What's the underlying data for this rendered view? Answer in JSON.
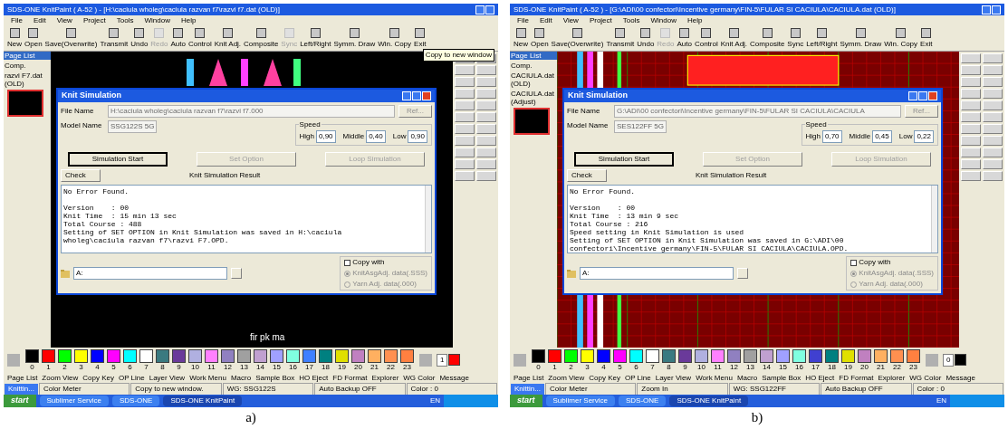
{
  "panels": [
    {
      "caption": "a)",
      "canvas": {
        "kind": "motif",
        "label": "fir pk ma"
      },
      "title": "SDS-ONE KnitPaint ( A-52 ) - [H:\\caciula wholeg\\caciula razvan f7\\razvi f7.dat (OLD)]",
      "menu": [
        "File",
        "Edit",
        "View",
        "Project",
        "Tools",
        "Window",
        "Help"
      ],
      "toolbar": [
        {
          "label": "New",
          "disabled": false
        },
        {
          "label": "Open",
          "disabled": false
        },
        {
          "label": "Save(Overwrite)",
          "disabled": false
        },
        {
          "label": "Transmit",
          "disabled": false
        },
        {
          "label": "Undo",
          "disabled": false
        },
        {
          "label": "Redo",
          "disabled": true
        },
        {
          "label": "Auto",
          "disabled": false
        },
        {
          "label": "Control",
          "disabled": false
        },
        {
          "label": "Knit Adj.",
          "disabled": false
        },
        {
          "label": "Composite",
          "disabled": false
        },
        {
          "label": "Sync",
          "disabled": true
        },
        {
          "label": "Left/Right",
          "disabled": false
        },
        {
          "label": "Symm. Draw",
          "disabled": false
        },
        {
          "label": "Win. Copy",
          "disabled": false
        },
        {
          "label": "Exit",
          "disabled": false
        }
      ],
      "tooltip": "Copy to new window",
      "sidebar": [
        {
          "label": "Page List",
          "selected": true
        },
        {
          "label": "Comp.",
          "selected": false
        },
        {
          "label": "razvi F7.dat (OLD)",
          "selected": false
        }
      ],
      "dialog": {
        "title": "Knit Simulation",
        "file_label": "File Name",
        "file_value": "H:\\caciula wholeg\\caciula razvan f7\\razvi f7.000",
        "ref_button": "Ref...",
        "model_label": "Model Name",
        "model_value": "SSG122S 5G",
        "speed_label": "Speed",
        "speeds": [
          {
            "label": "High",
            "value": "0,90"
          },
          {
            "label": "Middle",
            "value": "0,40"
          },
          {
            "label": "Low",
            "value": "0,90"
          }
        ],
        "buttons": [
          {
            "label": "Simulation Start",
            "disabled": false
          },
          {
            "label": "Set Option",
            "disabled": true
          },
          {
            "label": "Loop Simulation",
            "disabled": true
          }
        ],
        "check": "Check",
        "result_title": "Knit Simulation Result",
        "result": [
          "No Error Found.",
          "Version    : 00",
          "Knit Time  : 15 min 13 sec",
          "Total Course : 488",
          "Setting of SET OPTION in Knit Simulation was saved in H:\\caciula",
          "wholeg\\caciula razvan f7\\razvi F7.OPD."
        ],
        "drive": "A:",
        "copy_with": {
          "label": "Copy with",
          "checked": false
        },
        "radios": [
          {
            "label": "KnitAsgAdj. data(.SSS)",
            "selected": true
          },
          {
            "label": "Yarn Adj. data(.000)",
            "selected": false
          }
        ]
      },
      "palette": [
        {
          "n": "0",
          "color": "#000000"
        },
        {
          "n": "1",
          "color": "#ff0000"
        },
        {
          "n": "2",
          "color": "#00ff00"
        },
        {
          "n": "3",
          "color": "#ffff00"
        },
        {
          "n": "4",
          "color": "#0000ff"
        },
        {
          "n": "5",
          "color": "#ff00ff"
        },
        {
          "n": "6",
          "color": "#00ffff"
        },
        {
          "n": "7",
          "color": "#ffffff"
        },
        {
          "n": "8",
          "color": "#3a7a80"
        },
        {
          "n": "9",
          "color": "#6a3a9a"
        },
        {
          "n": "10",
          "color": "#b0b0e0"
        },
        {
          "n": "11",
          "color": "#ff80ff"
        },
        {
          "n": "12",
          "color": "#9080c0"
        },
        {
          "n": "13",
          "color": "#a0a0a0"
        },
        {
          "n": "14",
          "color": "#c0a0d0"
        },
        {
          "n": "15",
          "color": "#a0a0ff"
        },
        {
          "n": "16",
          "color": "#80ffe0"
        },
        {
          "n": "17",
          "color": "#4080ff"
        },
        {
          "n": "18",
          "color": "#008080"
        },
        {
          "n": "19",
          "color": "#e0e000"
        },
        {
          "n": "20",
          "color": "#c080c0"
        },
        {
          "n": "21",
          "color": "#ffb060"
        },
        {
          "n": "22",
          "color": "#ff9050"
        },
        {
          "n": "23",
          "color": "#ff8040"
        }
      ],
      "current_color": {
        "n": "1",
        "color": "#ff0000"
      },
      "bottom_tools": [
        "Page List",
        "Zoom View",
        "Copy Key",
        "OP Line",
        "Layer View",
        "Work Menu",
        "Macro",
        "Sample Box",
        "HO Eject",
        "FD Format",
        "Explorer",
        "WG Color",
        "Message"
      ],
      "status": [
        "Knittin...",
        "Color Meter",
        "Copy to new window.",
        "WG: SSG122S",
        "Auto Backup OFF",
        "Color : 0"
      ],
      "taskbar": {
        "start": "start",
        "items": [
          "Sublimer Service",
          "SDS-ONE",
          "SDS-ONE KnitPaint"
        ],
        "lang": "EN"
      }
    },
    {
      "caption": "b)",
      "canvas": {
        "kind": "grid"
      },
      "title": "SDS-ONE KnitPaint ( A-52 ) - [G:\\ADI\\00 confectori\\Incentive germany\\FIN-5\\FULAR SI CACIULA\\CACIULA.dat (OLD)]",
      "menu": [
        "File",
        "Edit",
        "View",
        "Project",
        "Tools",
        "Window",
        "Help"
      ],
      "toolbar": [
        {
          "label": "New",
          "disabled": false
        },
        {
          "label": "Open",
          "disabled": false
        },
        {
          "label": "Save(Overwrite)",
          "disabled": false
        },
        {
          "label": "Transmit",
          "disabled": false
        },
        {
          "label": "Undo",
          "disabled": false
        },
        {
          "label": "Redo",
          "disabled": true
        },
        {
          "label": "Auto",
          "disabled": false
        },
        {
          "label": "Control",
          "disabled": false
        },
        {
          "label": "Knit Adj.",
          "disabled": false
        },
        {
          "label": "Composite",
          "disabled": false
        },
        {
          "label": "Sync",
          "disabled": false
        },
        {
          "label": "Left/Right",
          "disabled": false
        },
        {
          "label": "Symm. Draw",
          "disabled": false
        },
        {
          "label": "Win. Copy",
          "disabled": false
        },
        {
          "label": "Exit",
          "disabled": false
        }
      ],
      "sidebar": [
        {
          "label": "Page List",
          "selected": true
        },
        {
          "label": "Comp.",
          "selected": false
        },
        {
          "label": "CACIULA.dat (OLD)",
          "selected": false
        },
        {
          "label": "CACIULA.dat (Adjust)",
          "selected": false
        }
      ],
      "dialog": {
        "title": "Knit Simulation",
        "file_label": "File Name",
        "file_value": "G:\\ADI\\00 confectori\\Incentive germany\\FIN-5\\FULAR SI CACIULA\\CACIULA",
        "ref_button": "Ref...",
        "model_label": "Model Name",
        "model_value": "SES122FF 5G",
        "speed_label": "Speed",
        "speeds": [
          {
            "label": "High",
            "value": "0,70"
          },
          {
            "label": "Middle",
            "value": "0,45"
          },
          {
            "label": "Low",
            "value": "0,22"
          }
        ],
        "buttons": [
          {
            "label": "Simulation Start",
            "disabled": false
          },
          {
            "label": "Set Option",
            "disabled": true
          },
          {
            "label": "Loop Simulation",
            "disabled": true
          }
        ],
        "check": "Check",
        "result_title": "Knit Simulation Result",
        "result": [
          "No Error Found.",
          "Version    : 00",
          "Knit Time  : 13 min 9 sec",
          "Total Course : 216",
          "Speed setting in Knit Simulation is used",
          "Setting of SET OPTION in Knit Simulation was saved in G:\\ADI\\00",
          "confectori\\Incentive germany\\FIN-5\\FULAR SI CACIULA\\CACIULA.OPD."
        ],
        "drive": "A:",
        "copy_with": {
          "label": "Copy with",
          "checked": false
        },
        "radios": [
          {
            "label": "KnitAsgAdj. data(.SSS)",
            "selected": true
          },
          {
            "label": "Yarn Adj. data(.000)",
            "selected": false
          }
        ]
      },
      "palette": [
        {
          "n": "0",
          "color": "#000000"
        },
        {
          "n": "1",
          "color": "#ff0000"
        },
        {
          "n": "2",
          "color": "#00ff00"
        },
        {
          "n": "3",
          "color": "#ffff00"
        },
        {
          "n": "4",
          "color": "#0000ff"
        },
        {
          "n": "5",
          "color": "#ff00ff"
        },
        {
          "n": "6",
          "color": "#00ffff"
        },
        {
          "n": "7",
          "color": "#ffffff"
        },
        {
          "n": "8",
          "color": "#3a7a80"
        },
        {
          "n": "9",
          "color": "#6a3a9a"
        },
        {
          "n": "10",
          "color": "#b0b0e0"
        },
        {
          "n": "11",
          "color": "#ff80ff"
        },
        {
          "n": "12",
          "color": "#9080c0"
        },
        {
          "n": "13",
          "color": "#a0a0a0"
        },
        {
          "n": "14",
          "color": "#c0a0d0"
        },
        {
          "n": "15",
          "color": "#a0a0ff"
        },
        {
          "n": "16",
          "color": "#80ffe0"
        },
        {
          "n": "17",
          "color": "#4040d0"
        },
        {
          "n": "18",
          "color": "#008080"
        },
        {
          "n": "19",
          "color": "#e0e000"
        },
        {
          "n": "20",
          "color": "#c080c0"
        },
        {
          "n": "21",
          "color": "#ffb060"
        },
        {
          "n": "22",
          "color": "#ff9050"
        },
        {
          "n": "23",
          "color": "#ff8040"
        }
      ],
      "current_color": {
        "n": "0",
        "color": "#000000"
      },
      "bottom_tools": [
        "Page List",
        "Zoom View",
        "Copy Key",
        "OP Line",
        "Layer View",
        "Work Menu",
        "Macro",
        "Sample Box",
        "HO Eject",
        "FD Format",
        "Explorer",
        "WG Color",
        "Message"
      ],
      "status": [
        "Knittin...",
        "Color Meter",
        "Zoom In",
        "WG: SSG122FF",
        "Auto Backup OFF",
        "Color : 0"
      ],
      "taskbar": {
        "start": "start",
        "items": [
          "Sublimer Service",
          "SDS-ONE",
          "SDS-ONE KnitPaint"
        ],
        "lang": "EN"
      }
    }
  ]
}
